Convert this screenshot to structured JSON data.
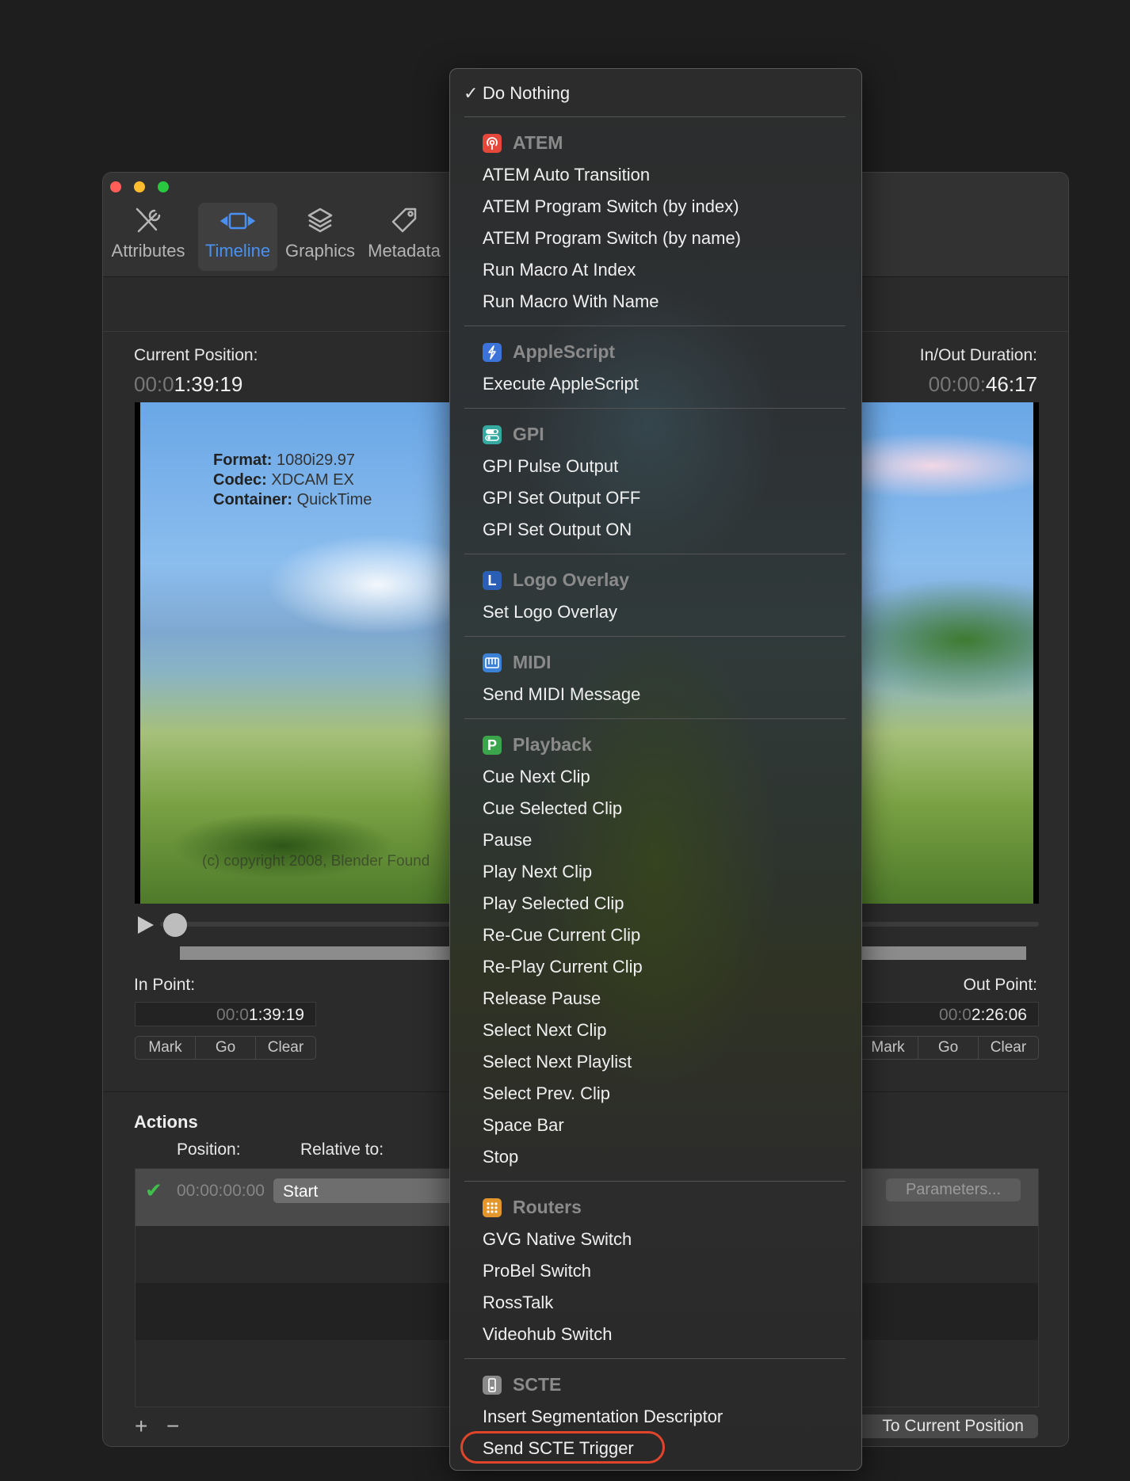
{
  "window": {
    "tabs": [
      {
        "label": "Attributes",
        "icon": "tools-icon"
      },
      {
        "label": "Timeline",
        "icon": "timeline-icon"
      },
      {
        "label": "Graphics",
        "icon": "layers-icon"
      },
      {
        "label": "Metadata",
        "icon": "tag-icon"
      }
    ],
    "current_position": {
      "label": "Current Position:",
      "dim": "00:0",
      "value": "1:39:19"
    },
    "inout_duration": {
      "label": "In/Out Duration:",
      "dim": "00:00:",
      "value": "46:17"
    },
    "video_overlay": {
      "format_label": "Format:",
      "format_value": "1080i29.97",
      "codec_label": "Codec:",
      "codec_value": "XDCAM EX",
      "container_label": "Container:",
      "container_value": "QuickTime",
      "copyright": "(c) copyright 2008, Blender Found"
    },
    "in_point": {
      "label": "In Point:",
      "dim": "00:0",
      "value": "1:39:19"
    },
    "out_point": {
      "label": "Out Point:",
      "dim": "00:0",
      "value": "2:26:06"
    },
    "buttons": {
      "mark": "Mark",
      "go": "Go",
      "clear": "Clear"
    },
    "actions": {
      "title": "Actions",
      "col_position": "Position:",
      "col_relative": "Relative to:",
      "row_position": "00:00:00:00",
      "row_relative": "Start",
      "parameters": "Parameters...",
      "add": "+",
      "remove": "−",
      "to_current": "To Current Position"
    }
  },
  "menu": {
    "checked": "Do Nothing",
    "check_mark": "✓",
    "sections": [
      {
        "header": "ATEM",
        "items": [
          "ATEM Auto Transition",
          "ATEM Program Switch (by index)",
          "ATEM Program Switch (by name)",
          "Run Macro At Index",
          "Run Macro With Name"
        ]
      },
      {
        "header": "AppleScript",
        "items": [
          "Execute AppleScript"
        ]
      },
      {
        "header": "GPI",
        "items": [
          "GPI Pulse Output",
          "GPI Set Output OFF",
          "GPI Set Output ON"
        ]
      },
      {
        "header": "Logo Overlay",
        "icon_letter": "L",
        "items": [
          "Set Logo Overlay"
        ]
      },
      {
        "header": "MIDI",
        "items": [
          "Send MIDI Message"
        ]
      },
      {
        "header": "Playback",
        "icon_letter": "P",
        "items": [
          "Cue Next Clip",
          "Cue Selected Clip",
          "Pause",
          "Play Next Clip",
          "Play Selected Clip",
          "Re-Cue Current Clip",
          "Re-Play Current Clip",
          "Release Pause",
          "Select Next Clip",
          "Select Next Playlist",
          "Select Prev. Clip",
          "Space Bar",
          "Stop"
        ]
      },
      {
        "header": "Routers",
        "items": [
          "GVG Native Switch",
          "ProBel Switch",
          "RossTalk",
          "Videohub Switch"
        ]
      },
      {
        "header": "SCTE",
        "items": [
          "Insert Segmentation Descriptor",
          "Send SCTE Trigger"
        ]
      }
    ]
  },
  "colors": {
    "accent": "#4a90f0",
    "highlight_ring": "#e0452c",
    "atem": "#e5473a",
    "applescript": "#3b73d9",
    "gpi": "#35a8a0",
    "logo": "#2b5fb5",
    "midi": "#3b82d6",
    "playback": "#3aa54b",
    "routers": "#e2962c",
    "scte": "#8a8a8a"
  }
}
